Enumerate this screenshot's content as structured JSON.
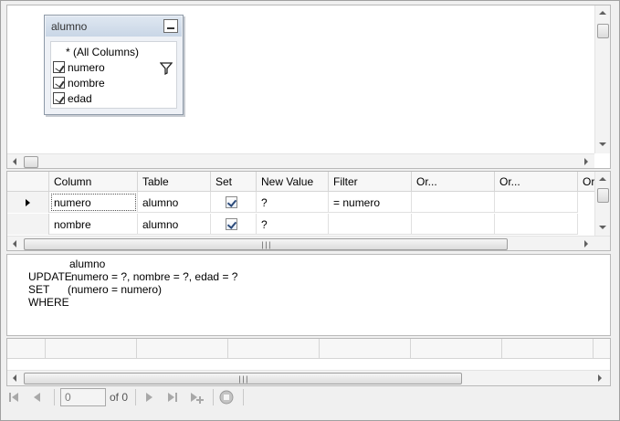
{
  "diagram": {
    "table_name": "alumno",
    "columns": [
      {
        "label": "* (All Columns)",
        "checked": false
      },
      {
        "label": "numero",
        "checked": true,
        "filter": true
      },
      {
        "label": "nombre",
        "checked": true
      },
      {
        "label": "edad",
        "checked": true
      }
    ]
  },
  "criteria_grid": {
    "headers": [
      "Column",
      "Table",
      "Set",
      "New Value",
      "Filter",
      "Or...",
      "Or...",
      "Or"
    ],
    "rows": [
      {
        "column": "numero",
        "table": "alumno",
        "set": true,
        "new_value": "?",
        "filter": "= numero",
        "current": true
      },
      {
        "column": "nombre",
        "table": "alumno",
        "set": true,
        "new_value": "?",
        "filter": "",
        "current": false
      }
    ]
  },
  "sql": {
    "lines": [
      {
        "keyword": "UPDATE",
        "arg": "alumno"
      },
      {
        "keyword": "SET",
        "arg": "numero = ?, nombre = ?, edad = ?"
      },
      {
        "keyword": "WHERE",
        "arg": "(numero = numero)"
      }
    ]
  },
  "navigator": {
    "position_value": "0",
    "of_text": "of 0"
  },
  "colors": {
    "pane_background": "#ffffff",
    "chrome_background": "#f0f0f0",
    "table_header": "#c9d6e6"
  }
}
